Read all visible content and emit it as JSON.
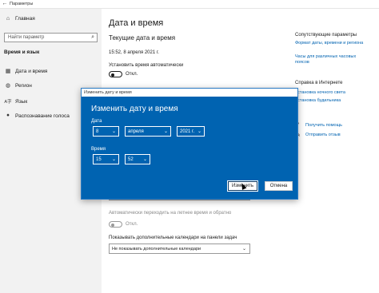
{
  "window": {
    "title": "Параметры",
    "back_glyph": "←"
  },
  "sidebar": {
    "home_label": "Главная",
    "search_placeholder": "Найти параметр",
    "section_title": "Время и язык",
    "items": [
      {
        "label": "Дата и время",
        "icon": "calendar-clock-icon",
        "glyph": "▦"
      },
      {
        "label": "Регион",
        "icon": "globe-icon",
        "glyph": "◍"
      },
      {
        "label": "Язык",
        "icon": "language-icon",
        "glyph": "A字"
      },
      {
        "label": "Распознавание голоса",
        "icon": "microphone-icon",
        "glyph": "🎙"
      }
    ]
  },
  "main": {
    "page_title": "Дата и время",
    "sub_title": "Текущие дата и время",
    "current_datetime": "15:52, 8 апреля 2021 г.",
    "auto_time_label": "Установить время автоматически",
    "auto_time_state": "Откл.",
    "partial_select_text": "…",
    "dst_label": "Автоматически переходить на летнее время и обратно",
    "dst_state": "Откл.",
    "calendars_label": "Показывать дополнительные календари на панели задач",
    "calendars_value": "Не показывать дополнительные календари"
  },
  "related": {
    "heading": "Сопутствующие параметры",
    "links": [
      "Формат даты, времени и региона",
      "Часы для различных часовых поясов"
    ]
  },
  "help": {
    "heading": "Справка в Интернете",
    "links": [
      "Установка ночного света",
      "Установка будильника"
    ],
    "get_help": "Получить помощь",
    "feedback": "Отправить отзыв"
  },
  "dialog": {
    "window_title": "Изменить дату и время",
    "heading": "Изменить дату и время",
    "date_label": "Дата",
    "day": "8",
    "month": "апреля",
    "year": "2021 г.",
    "time_label": "Время",
    "hour": "15",
    "minute": "52",
    "change_button": "Изменить",
    "cancel_button": "Отмена"
  },
  "colors": {
    "accent": "#0063b1",
    "link": "#0063b1",
    "sidebar_bg": "#f2f2f2"
  }
}
